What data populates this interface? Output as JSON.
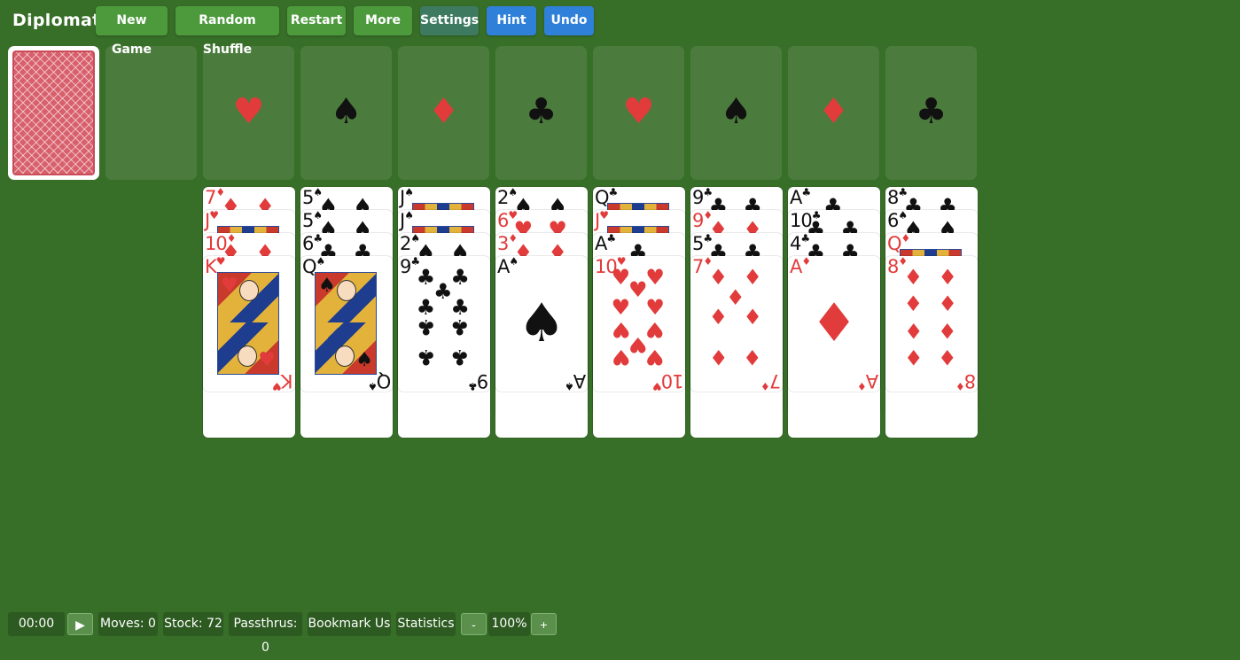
{
  "app": {
    "title": "Diplomat"
  },
  "toolbar": {
    "new_game": "New Game",
    "random_shuffle": "Random Shuffle",
    "restart": "Restart",
    "more": "More",
    "settings": "Settings",
    "hint": "Hint",
    "undo": "Undo"
  },
  "foundations": [
    {
      "suit": "♥",
      "color": "red"
    },
    {
      "suit": "♠",
      "color": "black"
    },
    {
      "suit": "♦",
      "color": "red"
    },
    {
      "suit": "♣",
      "color": "black"
    },
    {
      "suit": "♥",
      "color": "red"
    },
    {
      "suit": "♠",
      "color": "black"
    },
    {
      "suit": "♦",
      "color": "red"
    },
    {
      "suit": "♣",
      "color": "black"
    }
  ],
  "tableau": [
    [
      {
        "rank": "7",
        "suit": "♦"
      },
      {
        "rank": "J",
        "suit": "♥"
      },
      {
        "rank": "10",
        "suit": "♦"
      },
      {
        "rank": "K",
        "suit": "♥"
      }
    ],
    [
      {
        "rank": "5",
        "suit": "♠"
      },
      {
        "rank": "5",
        "suit": "♠"
      },
      {
        "rank": "6",
        "suit": "♣"
      },
      {
        "rank": "Q",
        "suit": "♠"
      }
    ],
    [
      {
        "rank": "J",
        "suit": "♠"
      },
      {
        "rank": "J",
        "suit": "♠"
      },
      {
        "rank": "2",
        "suit": "♠"
      },
      {
        "rank": "9",
        "suit": "♣"
      }
    ],
    [
      {
        "rank": "2",
        "suit": "♠"
      },
      {
        "rank": "6",
        "suit": "♥"
      },
      {
        "rank": "3",
        "suit": "♦"
      },
      {
        "rank": "A",
        "suit": "♠"
      }
    ],
    [
      {
        "rank": "Q",
        "suit": "♣"
      },
      {
        "rank": "J",
        "suit": "♥"
      },
      {
        "rank": "A",
        "suit": "♣"
      },
      {
        "rank": "10",
        "suit": "♥"
      }
    ],
    [
      {
        "rank": "9",
        "suit": "♣"
      },
      {
        "rank": "9",
        "suit": "♦"
      },
      {
        "rank": "5",
        "suit": "♣"
      },
      {
        "rank": "7",
        "suit": "♦"
      }
    ],
    [
      {
        "rank": "A",
        "suit": "♣"
      },
      {
        "rank": "10",
        "suit": "♣"
      },
      {
        "rank": "4",
        "suit": "♣"
      },
      {
        "rank": "A",
        "suit": "♦"
      }
    ],
    [
      {
        "rank": "8",
        "suit": "♣"
      },
      {
        "rank": "6",
        "suit": "♠"
      },
      {
        "rank": "Q",
        "suit": "♦"
      },
      {
        "rank": "8",
        "suit": "♦"
      }
    ]
  ],
  "status": {
    "timer": "00:00",
    "play_icon": "play-icon",
    "moves": "Moves: 0",
    "stock": "Stock: 72",
    "passthrus": "Passthrus: 0",
    "bookmark": "Bookmark Us",
    "statistics": "Statistics",
    "zoom_out": "-",
    "zoom": "100%",
    "zoom_in": "+"
  },
  "colors": {
    "felt": "#376e28",
    "red_suit": "#e23b3b",
    "black_suit": "#111111",
    "button_green": "#4d9a3d",
    "button_blue": "#2f80d8"
  }
}
